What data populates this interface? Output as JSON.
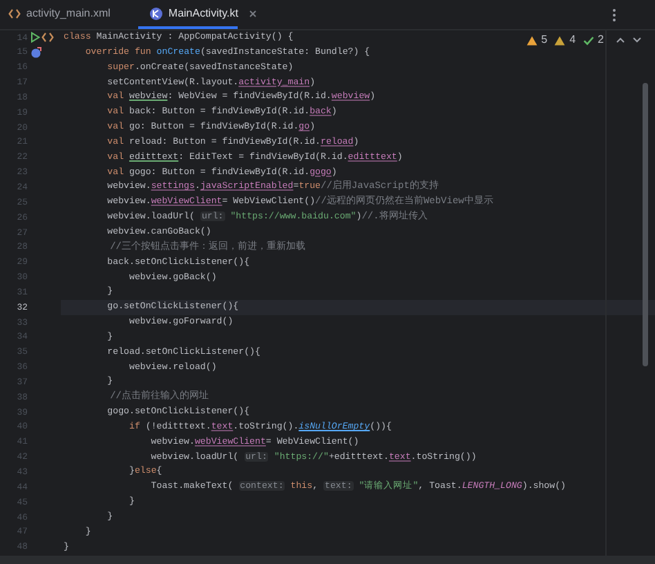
{
  "tabs": [
    {
      "label": "activity_main.xml",
      "kind": "xml",
      "selected": false
    },
    {
      "label": "MainActivity.kt",
      "kind": "kotlin",
      "selected": true
    }
  ],
  "inspections": [
    {
      "kind": "error",
      "count": "5"
    },
    {
      "kind": "warning",
      "count": "4"
    },
    {
      "kind": "ok",
      "count": "2"
    }
  ],
  "lines": [
    {
      "number": "14",
      "current": false,
      "gutter": [
        {
          "kind": "run"
        },
        {
          "kind": "code"
        }
      ],
      "segments": [
        {
          "text": "class",
          "kind": "keyword"
        },
        {
          "text": " MainActivity : AppCompatActivity() {",
          "kind": "plain"
        }
      ]
    },
    {
      "number": "15",
      "current": false,
      "gutter": [
        {
          "kind": "override"
        }
      ],
      "segments": [
        {
          "text": "    override fun ",
          "kind": "keyword"
        },
        {
          "text": "onCreate",
          "kind": "function"
        },
        {
          "text": "(savedInstanceState: Bundle?) {",
          "kind": "plain"
        }
      ]
    },
    {
      "number": "16",
      "current": false,
      "segments": [
        {
          "text": "        super",
          "kind": "keyword"
        },
        {
          "text": ".onCreate(savedInstanceState)",
          "kind": "plain"
        }
      ]
    },
    {
      "number": "17",
      "current": false,
      "segments": [
        {
          "text": "        setContentView(R.layout.",
          "kind": "plain"
        },
        {
          "text": "activity_main",
          "kind": "property"
        },
        {
          "text": ")",
          "kind": "plain"
        }
      ]
    },
    {
      "number": "18",
      "current": false,
      "segments": [
        {
          "text": "        val ",
          "kind": "keyword"
        },
        {
          "text": "webview",
          "kind": "underlined"
        },
        {
          "text": ": WebView = findViewById(R.id.",
          "kind": "plain"
        },
        {
          "text": "webview",
          "kind": "property"
        },
        {
          "text": ")",
          "kind": "plain"
        }
      ]
    },
    {
      "number": "19",
      "current": false,
      "segments": [
        {
          "text": "        val ",
          "kind": "keyword"
        },
        {
          "text": "back: Button = findViewById(R.id.",
          "kind": "plain"
        },
        {
          "text": "back",
          "kind": "property"
        },
        {
          "text": ")",
          "kind": "plain"
        }
      ]
    },
    {
      "number": "20",
      "current": false,
      "segments": [
        {
          "text": "        val ",
          "kind": "keyword"
        },
        {
          "text": "go: Button = findViewById(R.id.",
          "kind": "plain"
        },
        {
          "text": "go",
          "kind": "property"
        },
        {
          "text": ")",
          "kind": "plain"
        }
      ]
    },
    {
      "number": "21",
      "current": false,
      "segments": [
        {
          "text": "        val ",
          "kind": "keyword"
        },
        {
          "text": "reload: Button = findViewById(R.id.",
          "kind": "plain"
        },
        {
          "text": "reload",
          "kind": "property"
        },
        {
          "text": ")",
          "kind": "plain"
        }
      ]
    },
    {
      "number": "22",
      "current": false,
      "segments": [
        {
          "text": "        val ",
          "kind": "keyword"
        },
        {
          "text": "editttext",
          "kind": "underlined"
        },
        {
          "text": ": EditText = findViewById(R.id.",
          "kind": "plain"
        },
        {
          "text": "editttext",
          "kind": "property"
        },
        {
          "text": ")",
          "kind": "plain"
        }
      ]
    },
    {
      "number": "23",
      "current": false,
      "segments": [
        {
          "text": "        val ",
          "kind": "keyword"
        },
        {
          "text": "gogo: Button = findViewById(R.id.",
          "kind": "plain"
        },
        {
          "text": "gogo",
          "kind": "property"
        },
        {
          "text": ")",
          "kind": "plain"
        }
      ]
    },
    {
      "number": "24",
      "current": false,
      "segments": [
        {
          "text": "        webview.",
          "kind": "plain"
        },
        {
          "text": "settings",
          "kind": "property"
        },
        {
          "text": ".",
          "kind": "plain"
        },
        {
          "text": "javaScriptEnabled",
          "kind": "property"
        },
        {
          "text": "=",
          "kind": "plain"
        },
        {
          "text": "true",
          "kind": "keyword"
        },
        {
          "text": "//启用JavaScript的支持",
          "kind": "comment"
        }
      ]
    },
    {
      "number": "25",
      "current": false,
      "segments": [
        {
          "text": "        webview.",
          "kind": "plain"
        },
        {
          "text": "webViewClient",
          "kind": "property"
        },
        {
          "text": "= WebViewClient()",
          "kind": "plain"
        },
        {
          "text": "//远程的网页仍然在当前WebView中显示",
          "kind": "comment"
        }
      ]
    },
    {
      "number": "26",
      "current": false,
      "segments": [
        {
          "text": "        webview.loadUrl( ",
          "kind": "plain"
        },
        {
          "text": "url:",
          "kind": "hint"
        },
        {
          "text": " \"https://www.baidu.com\"",
          "kind": "string"
        },
        {
          "text": ")",
          "kind": "plain"
        },
        {
          "text": "//.将网址传入",
          "kind": "comment"
        }
      ]
    },
    {
      "number": "27",
      "current": false,
      "segments": [
        {
          "text": "        webview.canGoBack()",
          "kind": "plain"
        }
      ]
    },
    {
      "number": "28",
      "current": false,
      "segments": [
        {
          "text": "        //三个按钮点击事件：返回，前进，重新加载",
          "kind": "comment"
        }
      ]
    },
    {
      "number": "29",
      "current": false,
      "segments": [
        {
          "text": "        back.setOnClickListener(){",
          "kind": "plain"
        }
      ]
    },
    {
      "number": "30",
      "current": false,
      "segments": [
        {
          "text": "            webview.goBack()",
          "kind": "plain"
        }
      ]
    },
    {
      "number": "31",
      "current": false,
      "segments": [
        {
          "text": "        }",
          "kind": "plain"
        }
      ]
    },
    {
      "number": "32",
      "current": true,
      "segments": [
        {
          "text": "        go.setOnClickListener(){",
          "kind": "plain"
        }
      ]
    },
    {
      "number": "33",
      "current": false,
      "segments": [
        {
          "text": "            webview.goForward()",
          "kind": "plain"
        }
      ]
    },
    {
      "number": "34",
      "current": false,
      "segments": [
        {
          "text": "        }",
          "kind": "plain"
        }
      ]
    },
    {
      "number": "35",
      "current": false,
      "segments": [
        {
          "text": "        reload.setOnClickListener(){",
          "kind": "plain"
        }
      ]
    },
    {
      "number": "36",
      "current": false,
      "segments": [
        {
          "text": "            webview.reload()",
          "kind": "plain"
        }
      ]
    },
    {
      "number": "37",
      "current": false,
      "segments": [
        {
          "text": "        }",
          "kind": "plain"
        }
      ]
    },
    {
      "number": "38",
      "current": false,
      "segments": [
        {
          "text": "        //点击前往输入的网址",
          "kind": "comment"
        }
      ]
    },
    {
      "number": "39",
      "current": false,
      "segments": [
        {
          "text": "        gogo.setOnClickListener(){",
          "kind": "plain"
        }
      ]
    },
    {
      "number": "40",
      "current": false,
      "segments": [
        {
          "text": "            if ",
          "kind": "keyword"
        },
        {
          "text": "(!editttext.",
          "kind": "plain"
        },
        {
          "text": "text",
          "kind": "property"
        },
        {
          "text": ".toString().",
          "kind": "plain"
        },
        {
          "text": "isNullOrEmpty",
          "kind": "extension"
        },
        {
          "text": "()){",
          "kind": "plain"
        }
      ]
    },
    {
      "number": "41",
      "current": false,
      "segments": [
        {
          "text": "                webview.",
          "kind": "plain"
        },
        {
          "text": "webViewClient",
          "kind": "property"
        },
        {
          "text": "= WebViewClient()",
          "kind": "plain"
        }
      ]
    },
    {
      "number": "42",
      "current": false,
      "segments": [
        {
          "text": "                webview.loadUrl( ",
          "kind": "plain"
        },
        {
          "text": "url:",
          "kind": "hint"
        },
        {
          "text": " \"https://\"",
          "kind": "string"
        },
        {
          "text": "+editttext.",
          "kind": "plain"
        },
        {
          "text": "text",
          "kind": "property"
        },
        {
          "text": ".toString())",
          "kind": "plain"
        }
      ]
    },
    {
      "number": "43",
      "current": false,
      "segments": [
        {
          "text": "            }",
          "kind": "plain"
        },
        {
          "text": "else",
          "kind": "keyword"
        },
        {
          "text": "{",
          "kind": "plain"
        }
      ]
    },
    {
      "number": "44",
      "current": false,
      "segments": [
        {
          "text": "                Toast.makeText( ",
          "kind": "plain"
        },
        {
          "text": "context:",
          "kind": "hint"
        },
        {
          "text": " this",
          "kind": "keyword"
        },
        {
          "text": ", ",
          "kind": "plain"
        },
        {
          "text": "text:",
          "kind": "hint"
        },
        {
          "text": " \"请输入网址\"",
          "kind": "string"
        },
        {
          "text": ", Toast.",
          "kind": "plain"
        },
        {
          "text": "LENGTH_LONG",
          "kind": "static"
        },
        {
          "text": ").show()",
          "kind": "plain"
        }
      ]
    },
    {
      "number": "45",
      "current": false,
      "segments": [
        {
          "text": "            }",
          "kind": "plain"
        }
      ]
    },
    {
      "number": "46",
      "current": false,
      "segments": [
        {
          "text": "        }",
          "kind": "plain"
        }
      ]
    },
    {
      "number": "47",
      "current": false,
      "segments": [
        {
          "text": "    }",
          "kind": "plain"
        }
      ]
    },
    {
      "number": "48",
      "current": false,
      "segments": [
        {
          "text": "}",
          "kind": "plain"
        }
      ]
    }
  ]
}
